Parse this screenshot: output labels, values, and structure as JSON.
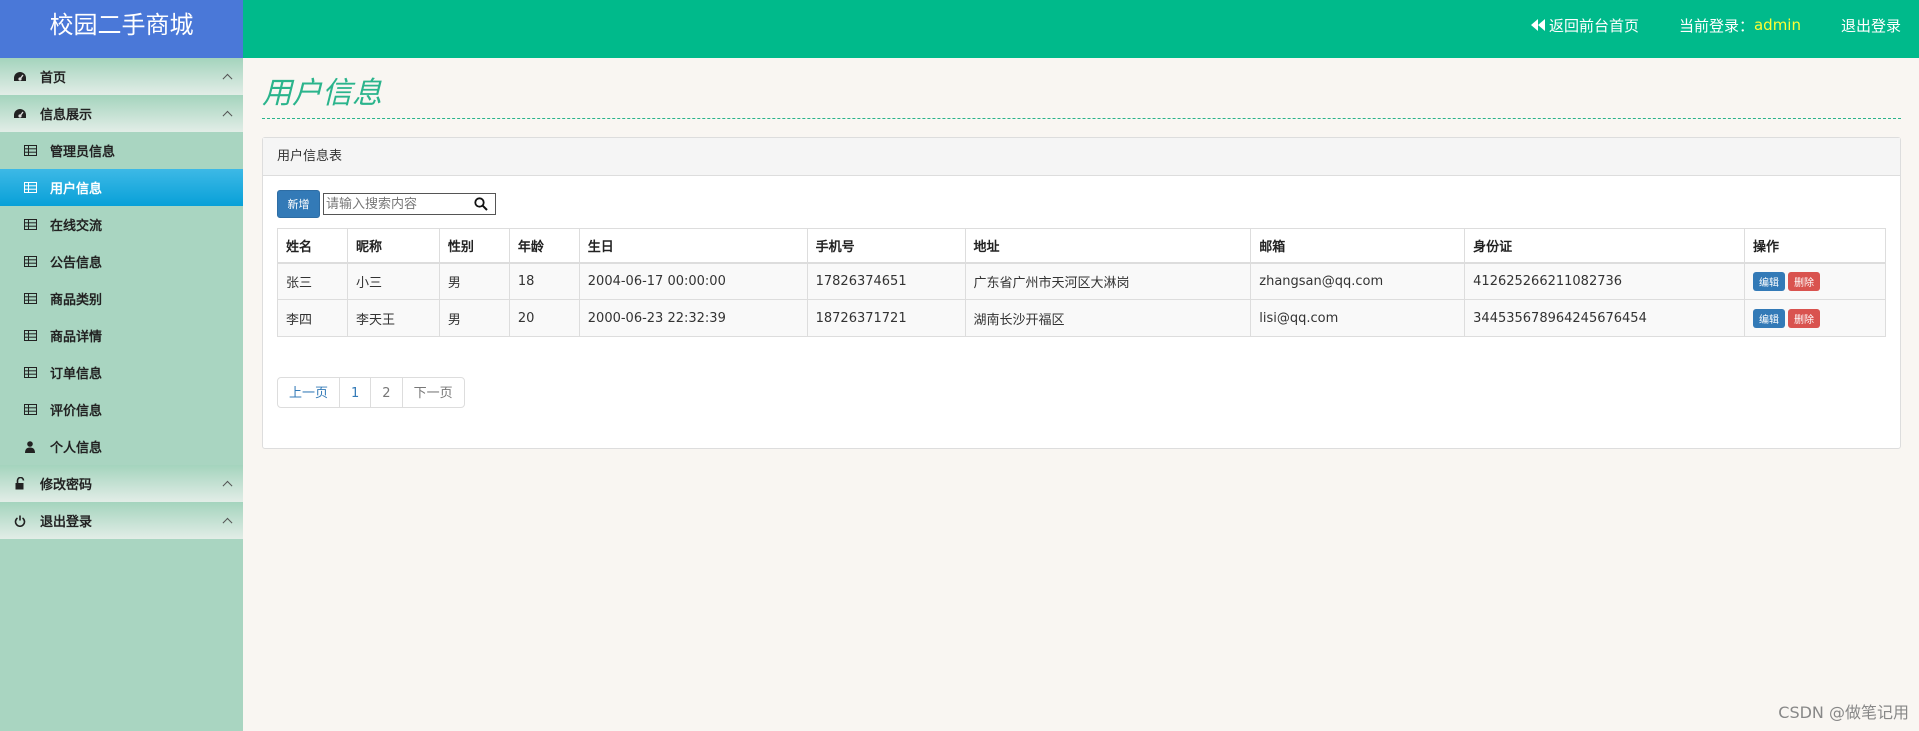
{
  "app": {
    "title": "校园二手商城"
  },
  "header": {
    "back_label": "返回前台首页",
    "login_prefix": "当前登录：",
    "username": "admin",
    "logout_label": "退出登录"
  },
  "sidebar": {
    "items": [
      {
        "label": "首页",
        "type": "group",
        "icon": "dashboard-icon"
      },
      {
        "label": "信息展示",
        "type": "group",
        "icon": "dashboard-icon"
      },
      {
        "label": "管理员信息",
        "type": "sub",
        "icon": "table-icon"
      },
      {
        "label": "用户信息",
        "type": "sub",
        "icon": "table-icon",
        "active": true
      },
      {
        "label": "在线交流",
        "type": "sub",
        "icon": "table-icon"
      },
      {
        "label": "公告信息",
        "type": "sub",
        "icon": "table-icon"
      },
      {
        "label": "商品类别",
        "type": "sub",
        "icon": "table-icon"
      },
      {
        "label": "商品详情",
        "type": "sub",
        "icon": "table-icon"
      },
      {
        "label": "订单信息",
        "type": "sub",
        "icon": "table-icon"
      },
      {
        "label": "评价信息",
        "type": "sub",
        "icon": "table-icon"
      },
      {
        "label": "个人信息",
        "type": "sub",
        "icon": "user-icon"
      },
      {
        "label": "修改密码",
        "type": "group",
        "icon": "unlock-icon"
      },
      {
        "label": "退出登录",
        "type": "group",
        "icon": "power-icon"
      }
    ]
  },
  "main": {
    "page_title": "用户信息",
    "panel_title": "用户信息表",
    "add_label": "新增",
    "search_placeholder": "请输入搜索内容",
    "table": {
      "headers": [
        "姓名",
        "昵称",
        "性别",
        "年龄",
        "生日",
        "手机号",
        "地址",
        "邮箱",
        "身份证",
        "操作"
      ],
      "rows": [
        [
          "张三",
          "小三",
          "男",
          "18",
          "2004-06-17 00:00:00",
          "17826374651",
          "广东省广州市天河区大淋岗",
          "zhangsan@qq.com",
          "412625266211082736"
        ],
        [
          "李四",
          "李天王",
          "男",
          "20",
          "2000-06-23 22:32:39",
          "18726371721",
          "湖南长沙开福区",
          "lisi@qq.com",
          "344535678964245676454"
        ]
      ],
      "edit_label": "编辑",
      "delete_label": "删除"
    },
    "pager": {
      "prev": "上一页",
      "pages": [
        "1",
        "2"
      ],
      "next": "下一页"
    }
  },
  "watermark": "CSDN @做笔记用",
  "colors": {
    "topbar": "#00ba8b",
    "brand": "#4a78d8",
    "sidebar": "#a9d5c1",
    "active": "#08a0d8",
    "accent": "#2bb48c"
  }
}
